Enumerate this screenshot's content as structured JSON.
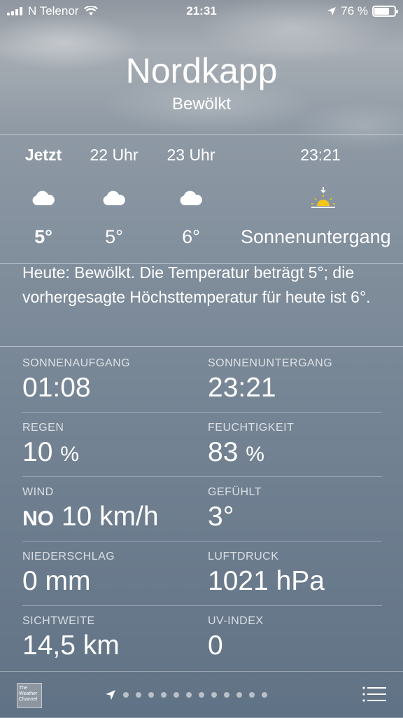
{
  "status_bar": {
    "carrier": "N Telenor",
    "time": "21:31",
    "battery": "76 %",
    "battery_level": 0.76
  },
  "header": {
    "city": "Nordkapp",
    "condition": "Bewölkt"
  },
  "hourly": [
    {
      "time": "Jetzt",
      "icon": "cloud-icon",
      "value": "5°"
    },
    {
      "time": "22 Uhr",
      "icon": "cloud-icon",
      "value": "5°"
    },
    {
      "time": "23 Uhr",
      "icon": "cloud-icon",
      "value": "6°"
    },
    {
      "time": "23:21",
      "icon": "sunset-icon",
      "value": "Sonnenuntergang"
    }
  ],
  "summary": "Heute: Bewölkt. Die Temperatur beträgt 5°; die vorhergesagte Höchsttemperatur für heute ist 6°.",
  "details": [
    {
      "label": "SONNENAUFGANG",
      "value": "01:08"
    },
    {
      "label": "SONNENUNTERGANG",
      "value": "23:21"
    },
    {
      "label": "REGEN",
      "value": "10",
      "unit": "%"
    },
    {
      "label": "FEUCHTIGKEIT",
      "value": "83",
      "unit": "%"
    },
    {
      "label": "WIND",
      "dir": "NO",
      "value": "10 km/h"
    },
    {
      "label": "GEFÜHLT",
      "value": "3°"
    },
    {
      "label": "NIEDERSCHLAG",
      "value": "0 mm"
    },
    {
      "label": "LUFTDRUCK",
      "value": "1021 hPa"
    },
    {
      "label": "SICHTWEITE",
      "value": "14,5 km"
    },
    {
      "label": "UV-INDEX",
      "value": "0"
    }
  ],
  "bottom": {
    "logo_text": "The Weather Channel",
    "page_count": 13,
    "current_page_icon": "location-arrow-icon",
    "list_icon": "list-icon"
  },
  "colors": {
    "sun": "#f5c518",
    "text": "#ffffff"
  }
}
